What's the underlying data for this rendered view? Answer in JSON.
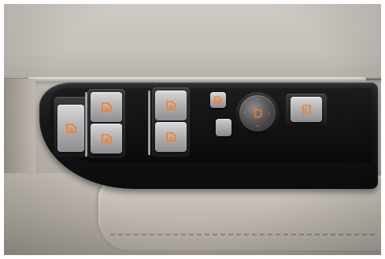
{
  "scene": {
    "subject": "car-door-window-switch-panel",
    "colors": {
      "leather": "#c3bdb5",
      "panel": "#161618",
      "button_silver": "#b4b4b7",
      "indicator_orange": "#ff7a1a"
    },
    "buttons": [
      {
        "name": "window-switch-driver-left",
        "icon": "window-icon"
      },
      {
        "name": "window-switch-front-upper",
        "icon": "window-icon"
      },
      {
        "name": "window-switch-front-lower",
        "icon": "window-icon"
      },
      {
        "name": "window-switch-rear-upper",
        "icon": "window-icon"
      },
      {
        "name": "window-switch-rear-lower",
        "icon": "window-icon"
      },
      {
        "name": "child-lock-button",
        "icon": "window-lock-icon"
      },
      {
        "name": "mirror-fold-button",
        "icon": "mirror-fold-icon"
      }
    ],
    "mirror_control": {
      "icon": "mirror-adjust-icon",
      "arrows": [
        "‹",
        "›",
        "⌃",
        "⌄"
      ]
    }
  }
}
